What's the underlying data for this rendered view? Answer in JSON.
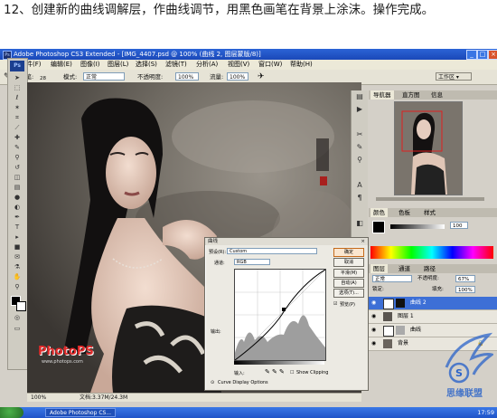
{
  "caption": {
    "text": "12、创建新的曲线调解层，作曲线调节，用黑色画笔在背景上涂沫。操作完成。"
  },
  "window": {
    "title": "Adobe Photoshop CS3 Extended - [IMG_4407.psd @ 100% (曲线 2, 图层蒙版/8)]",
    "ps_badge": "Ps",
    "minimize": "_",
    "maximize": "□",
    "close": "×"
  },
  "menu": {
    "items": [
      "文件(F)",
      "编辑(E)",
      "图像(I)",
      "图层(L)",
      "选择(S)",
      "滤镜(T)",
      "分析(A)",
      "视图(V)",
      "窗口(W)",
      "帮助(H)"
    ]
  },
  "options": {
    "brush_label": "画笔:",
    "brush_size": "28",
    "mode_label": "模式:",
    "mode_value": "正常",
    "opacity_label": "不透明度:",
    "opacity_value": "100%",
    "flow_label": "流量:",
    "flow_value": "100%",
    "workspace": "工作区 ▾"
  },
  "toolbox": {
    "logo": "Ps"
  },
  "document": {
    "zoom": "100%",
    "doc_size": "文档:3.37M/24.3M",
    "brand": "PhotoPS",
    "url": "www.photops.com"
  },
  "panels": {
    "navigator_tabs": [
      "导航器",
      "直方图",
      "信息"
    ],
    "color_tabs": [
      "颜色",
      "色板",
      "样式"
    ],
    "color_value": "100",
    "layers_tabs": [
      "图层",
      "通道",
      "路径"
    ],
    "blend_mode": "正常",
    "opacity_label": "不透明度:",
    "opacity_value": "67%",
    "lock_label": "锁定:",
    "fill_label": "填充:",
    "fill_value": "100%",
    "layers": [
      {
        "name": "曲线 2",
        "selected": true
      },
      {
        "name": "图层 1",
        "selected": false
      },
      {
        "name": "曲线",
        "selected": false
      },
      {
        "name": "背景",
        "selected": false
      }
    ]
  },
  "curves_dialog": {
    "title": "曲线",
    "preset_label": "预设(R):",
    "preset_value": "Custom",
    "channel_label": "通道:",
    "channel_value": "RGB",
    "output_label": "输出:",
    "input_label": "输入:",
    "buttons": [
      "确定",
      "取消",
      "平滑(M)",
      "自动(A)",
      "选项(T)..."
    ],
    "preview_label": "预览(P)",
    "clipping_label": "Show Clipping",
    "display_options": "Curve Display Options"
  },
  "taskbar": {
    "task_label": "Adobe Photoshop CS...",
    "clock": "17:59"
  },
  "watermark": {
    "text": "思缘联盟"
  }
}
